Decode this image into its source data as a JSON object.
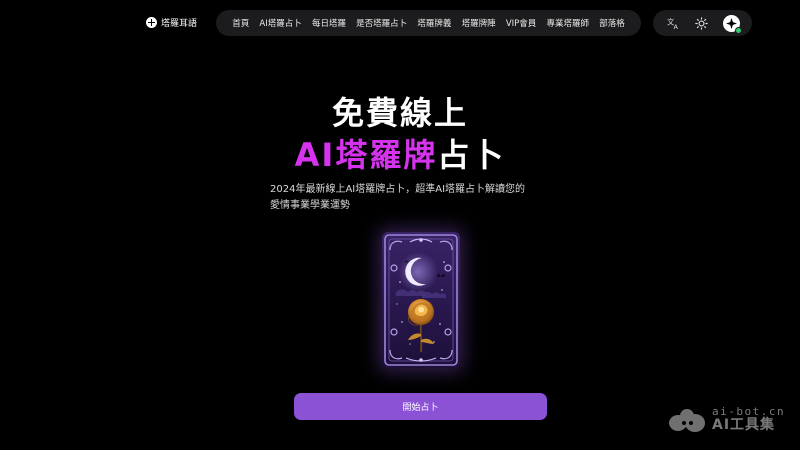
{
  "header": {
    "logo_text": "塔羅耳語",
    "nav": [
      "首頁",
      "AI塔羅占卜",
      "每日塔羅",
      "是否塔羅占卜",
      "塔羅牌義",
      "塔羅牌陣",
      "VIP會員",
      "專業塔羅師",
      "部落格"
    ],
    "tools": {
      "language_icon": "translate-icon",
      "theme_icon": "sun-icon",
      "account_icon": "sparkle-avatar-icon"
    }
  },
  "hero": {
    "title_line1": "免費線上",
    "title_line2_accent": "AI塔羅牌",
    "title_line2_plain": "占卜",
    "subtitle_line1": "2024年最新線上AI塔羅牌占卜，超準AI塔羅占卜解讀您的",
    "subtitle_line2": "愛情事業學業運勢",
    "card_image": "moon-rose-tarot-card",
    "start_button": "開始占卜"
  },
  "watermark": {
    "line1": "ai-bot.cn",
    "line2": "AI工具集"
  },
  "colors": {
    "accent": "#d633ee",
    "button": "#8b52d6",
    "background": "#000000",
    "nav_bg": "#1c1c1e"
  }
}
